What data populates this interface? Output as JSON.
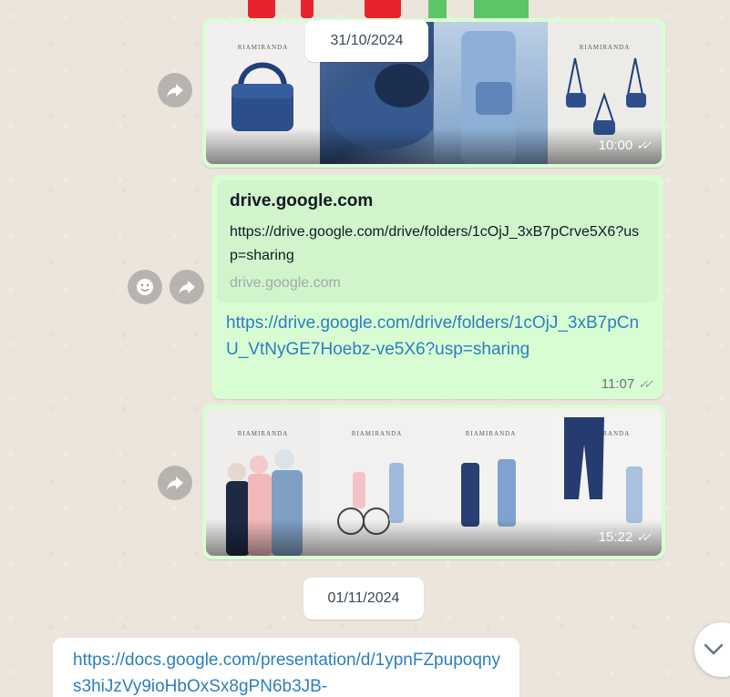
{
  "dates": {
    "first": "31/10/2024",
    "second": "01/11/2024"
  },
  "messages": {
    "images_1": {
      "time": "10:00",
      "brand": "RIAMIRANDA",
      "status": "read"
    },
    "link_message": {
      "preview_title": "drive.google.com",
      "preview_description": "https://drive.google.com/drive/folders/1cOjJ_3xB7pCrve5X6?usp=sharing",
      "preview_domain": "drive.google.com",
      "link": "https://drive.google.com/drive/folders/1cOjJ_3xB7pCnU_VtNyGE7Hoebz-ve5X6?usp=sharing",
      "time": "11:07",
      "status": "read"
    },
    "images_2": {
      "time": "15:22",
      "brand": "RIAMIRANDA",
      "status": "read"
    },
    "incoming_link": {
      "link": "https://docs.google.com/presentation/d/1ypnFZpupoqnys3hiJzVy9ioHbOxSx8gPN6b3JB-"
    }
  },
  "icons": {
    "forward": "forward-arrow-icon",
    "react": "smiley-icon",
    "scroll": "chevron-down-icon",
    "read_ticks": "double-check-icon"
  },
  "colors": {
    "outgoing_bubble": "#d9fdd3",
    "incoming_bubble": "#ffffff",
    "link": "#2a7fc0",
    "wallpaper": "#ebe5dc"
  }
}
